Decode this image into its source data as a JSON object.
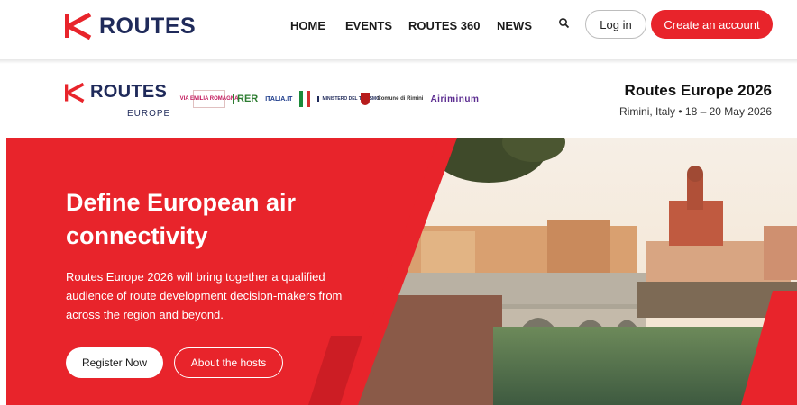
{
  "topnav": {
    "brand": "ROUTES",
    "links": [
      "HOME",
      "EVENTS",
      "ROUTES 360",
      "NEWS"
    ],
    "login_label": "Log in",
    "create_label": "Create an account",
    "icons": {
      "search": "search-icon",
      "brand": "routes-logo-icon"
    }
  },
  "event_header": {
    "brand": "ROUTES",
    "brand_sub": "EUROPE",
    "title": "Routes Europe 2026",
    "subtitle": "Rimini, Italy • 18 – 20 May 2026",
    "sponsors": {
      "emilia": "VIA EMILIA ROMAGNA",
      "rer": "RER",
      "italia": "ITALIA.IT",
      "ministero": "MINISTERO DEL TURISMO",
      "rimini": "Comune di Rimini",
      "riminiair": "Airiminum"
    }
  },
  "hero": {
    "title": "Define European air connectivity",
    "description": "Routes Europe 2026 will bring together a qualified audience of route development decision-makers from across the region and beyond.",
    "register_label": "Register Now",
    "hosts_label": "About the hosts"
  },
  "colors": {
    "accent": "#e8242b",
    "brand_navy": "#1f2a5a"
  }
}
